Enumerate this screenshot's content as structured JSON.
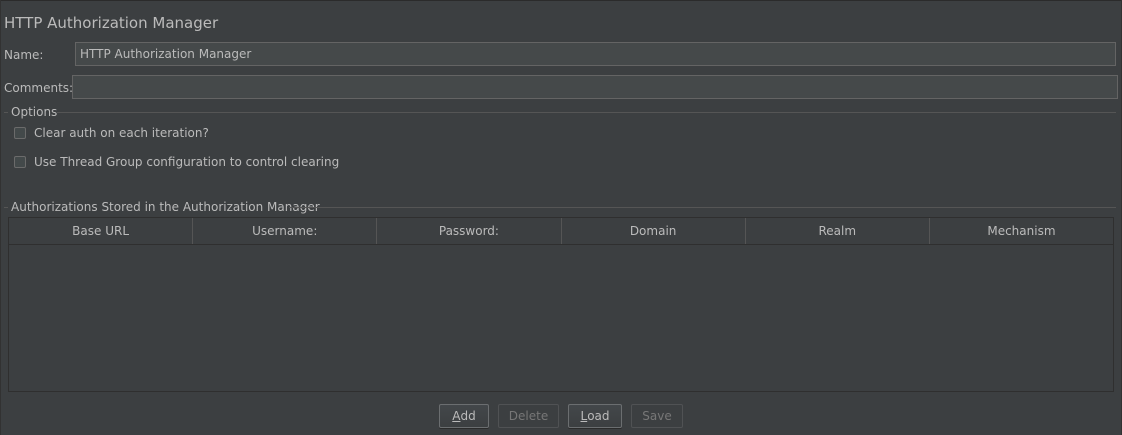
{
  "title": "HTTP Authorization Manager",
  "name_field": {
    "label": "Name:",
    "value": "HTTP Authorization Manager"
  },
  "comments_field": {
    "label": "Comments:",
    "value": ""
  },
  "options": {
    "title": "Options",
    "checkboxes": [
      {
        "label": "Clear auth on each iteration?",
        "checked": false
      },
      {
        "label": "Use Thread Group configuration to control clearing",
        "checked": false
      }
    ]
  },
  "authorizations": {
    "title": "Authorizations Stored in the Authorization Manager",
    "columns": [
      "Base URL",
      "Username:",
      "Password:",
      "Domain",
      "Realm",
      "Mechanism"
    ],
    "rows": []
  },
  "buttons": {
    "add": {
      "mnemonic": "A",
      "rest": "dd",
      "enabled": true
    },
    "delete": {
      "label": "Delete",
      "enabled": false
    },
    "load": {
      "mnemonic": "L",
      "rest": "oad",
      "enabled": true
    },
    "save": {
      "label": "Save",
      "enabled": false
    }
  },
  "colors": {
    "background": "#3c3f41",
    "text": "#bbbbbb",
    "input_background": "#45494a",
    "disabled_text": "#777777"
  }
}
